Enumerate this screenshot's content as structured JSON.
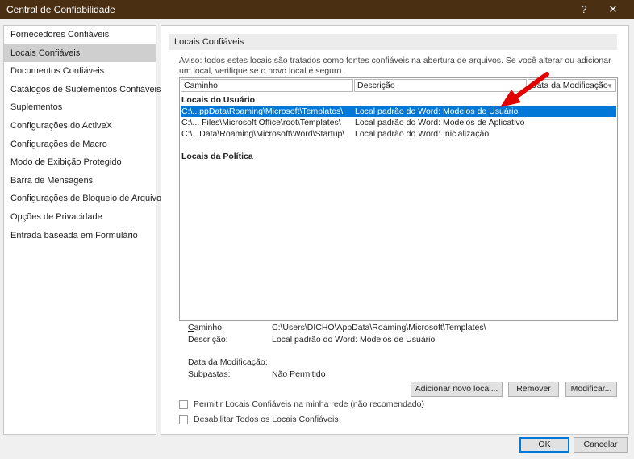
{
  "window": {
    "title": "Central de Confiabilidade",
    "help": "?",
    "close": "✕"
  },
  "sidebar": {
    "items": [
      {
        "label": "Fornecedores Confiáveis"
      },
      {
        "label": "Locais Confiáveis",
        "selected": true
      },
      {
        "label": "Documentos Confiáveis"
      },
      {
        "label": "Catálogos de Suplementos Confiáveis"
      },
      {
        "label": "Suplementos"
      },
      {
        "label": "Configurações do ActiveX"
      },
      {
        "label": "Configurações de Macro"
      },
      {
        "label": "Modo de Exibição Protegido"
      },
      {
        "label": "Barra de Mensagens"
      },
      {
        "label": "Configurações de Bloqueio de Arquivo"
      },
      {
        "label": "Opções de Privacidade"
      },
      {
        "label": "Entrada baseada em Formulário"
      }
    ]
  },
  "main": {
    "section_title": "Locais Confiáveis",
    "notice": "Aviso: todos estes locais são tratados como fontes confiáveis na abertura de arquivos.  Se você alterar ou adicionar um local, verifique se o novo local é seguro.",
    "columns": {
      "path": "Caminho",
      "description": "Descrição",
      "date": "Data da Modificação"
    },
    "group_user": "Locais do Usuário",
    "rows": [
      {
        "path": "C:\\...ppData\\Roaming\\Microsoft\\Templates\\",
        "description": "Local padrão do Word: Modelos de Usuário",
        "selected": true
      },
      {
        "path": "C:\\... Files\\Microsoft Office\\root\\Templates\\",
        "description": "Local padrão do Word: Modelos de Aplicativo"
      },
      {
        "path": "C:\\...Data\\Roaming\\Microsoft\\Word\\Startup\\",
        "description": "Local padrão do Word: Inicialização"
      }
    ],
    "group_policy": "Locais da Política",
    "details": {
      "path_label": "Caminho:",
      "path_value": "C:\\Users\\DICHO\\AppData\\Roaming\\Microsoft\\Templates\\",
      "description_label": "Descrição:",
      "description_value": "Local padrão do Word: Modelos de Usuário",
      "date_label": "Data da Modificação:",
      "date_value": "",
      "subfolders_label": "Subpastas:",
      "subfolders_value": "Não Permitido"
    },
    "buttons": {
      "add": "Adicionar novo local...",
      "remove": "Remover",
      "modify": "Modificar..."
    },
    "checkboxes": {
      "allow_network": {
        "label": "Permitir Locais Confiáveis na minha rede (não recomendado)",
        "checked": false
      },
      "disable_all": {
        "label": "Desabilitar Todos os Locais Confiáveis",
        "checked": false
      }
    }
  },
  "footer": {
    "ok": "OK",
    "cancel": "Cancelar"
  },
  "colors": {
    "titlebar": "#4b2f12",
    "selection": "#0078d7",
    "annotation_arrow": "#e00000"
  }
}
